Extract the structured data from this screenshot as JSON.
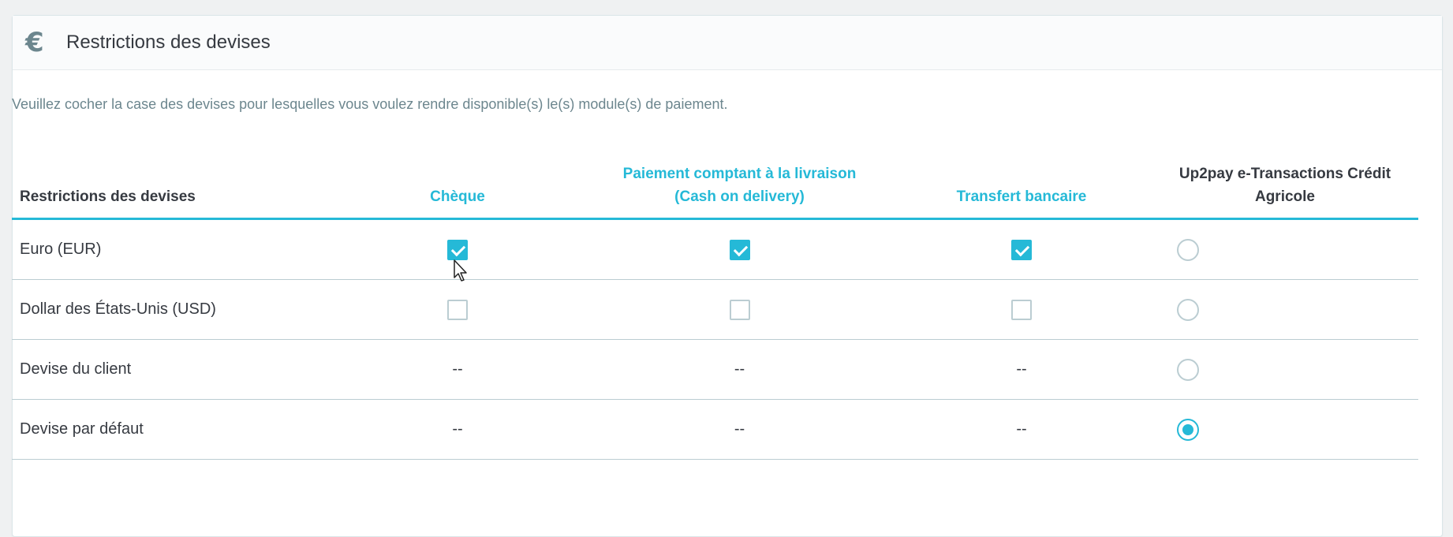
{
  "panel": {
    "icon": "euro-icon",
    "title": "Restrictions des devises",
    "help_text": "Veuillez cocher la case des devises pour lesquelles vous voulez rendre disponible(s) le(s) module(s) de paiement."
  },
  "table": {
    "headers": {
      "label": "Restrictions des devises",
      "cheque": "Chèque",
      "cod_line1": "Paiement comptant à la livraison",
      "cod_line2": "(Cash on delivery)",
      "transfer": "Transfert bancaire",
      "up2pay_line1": "Up2pay e-Transactions Crédit",
      "up2pay_line2": "Agricole"
    },
    "rows": [
      {
        "label": "Euro (EUR)",
        "cheque": true,
        "cod": true,
        "transfer": true,
        "up2pay": false
      },
      {
        "label": "Dollar des États-Unis (USD)",
        "cheque": false,
        "cod": false,
        "transfer": false,
        "up2pay": false
      },
      {
        "label": "Devise du client",
        "cheque": "--",
        "cod": "--",
        "transfer": "--",
        "up2pay": false
      },
      {
        "label": "Devise par défaut",
        "cheque": "--",
        "cod": "--",
        "transfer": "--",
        "up2pay": true
      }
    ]
  },
  "colors": {
    "accent": "#25b9d7",
    "border": "#bbcdd2",
    "text": "#363a41",
    "muted": "#6c868e"
  }
}
